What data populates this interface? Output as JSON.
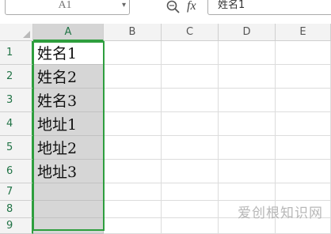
{
  "name_box": {
    "value": "A1"
  },
  "formula_bar": {
    "fx_label": "fx",
    "value": "姓名1"
  },
  "columns": [
    "A",
    "B",
    "C",
    "D",
    "E"
  ],
  "rows": [
    {
      "num": "1",
      "a": "姓名1"
    },
    {
      "num": "2",
      "a": "姓名2"
    },
    {
      "num": "3",
      "a": "姓名3"
    },
    {
      "num": "4",
      "a": "地址1"
    },
    {
      "num": "5",
      "a": "地址2"
    },
    {
      "num": "6",
      "a": "地址3"
    },
    {
      "num": "7",
      "a": ""
    },
    {
      "num": "8",
      "a": ""
    },
    {
      "num": "9",
      "a": ""
    }
  ],
  "selection": {
    "range": "A1:A9",
    "active_cell": "A1"
  },
  "colors": {
    "selection_border": "#2e9e3e",
    "selected_fill": "#d6d6d6"
  },
  "watermark": "爱创根知识网"
}
